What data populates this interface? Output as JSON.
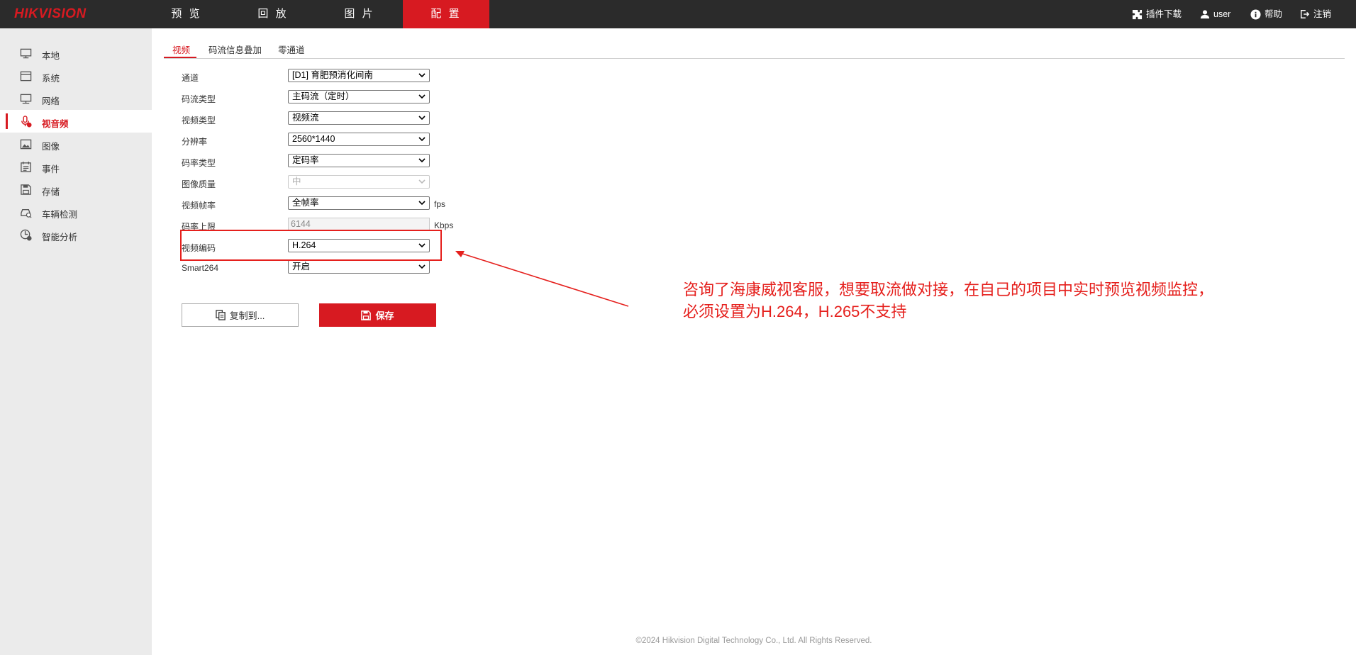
{
  "brand": {
    "logo": "HIKVISION",
    "accent": "#d71a21"
  },
  "nav": {
    "items": [
      "预 览",
      "回 放",
      "图 片",
      "配 置"
    ],
    "active": "配 置"
  },
  "top_right": {
    "plugin": "插件下载",
    "user": "user",
    "help": "帮助",
    "logout": "注销"
  },
  "sidebar": {
    "items": [
      {
        "label": "本地",
        "icon": "monitor-icon"
      },
      {
        "label": "系统",
        "icon": "window-icon"
      },
      {
        "label": "网络",
        "icon": "network-icon"
      },
      {
        "label": "视音频",
        "icon": "microphone-icon",
        "active": true
      },
      {
        "label": "图像",
        "icon": "image-icon"
      },
      {
        "label": "事件",
        "icon": "calendar-icon"
      },
      {
        "label": "存储",
        "icon": "save-icon"
      },
      {
        "label": "车辆检测",
        "icon": "car-search-icon"
      },
      {
        "label": "智能分析",
        "icon": "smart-analysis-icon"
      }
    ]
  },
  "tabs": [
    "视频",
    "码流信息叠加",
    "零通道"
  ],
  "form": {
    "channel": {
      "label": "通道",
      "value": "[D1] 育肥预消化间南"
    },
    "stream_type": {
      "label": "码流类型",
      "value": "主码流（定时）"
    },
    "video_type": {
      "label": "视频类型",
      "value": "视频流"
    },
    "resolution": {
      "label": "分辨率",
      "value": "2560*1440"
    },
    "bitrate_type": {
      "label": "码率类型",
      "value": "定码率"
    },
    "image_quality": {
      "label": "图像质量",
      "value": "中"
    },
    "frame_rate": {
      "label": "视频帧率",
      "value": "全帧率",
      "unit": "fps"
    },
    "bitrate_limit": {
      "label": "码率上限",
      "value": "6144",
      "unit": "Kbps"
    },
    "video_encoding": {
      "label": "视频编码",
      "value": "H.264"
    },
    "smart264": {
      "label": "Smart264",
      "value": "开启"
    }
  },
  "buttons": {
    "copy": "复制到...",
    "save": "保存"
  },
  "annotation": "咨询了海康威视客服，想要取流做对接，在自己的项目中实时预览视频监控，\n必须设置为H.264，H.265不支持",
  "footer": "©2024 Hikvision Digital Technology Co., Ltd. All Rights Reserved."
}
